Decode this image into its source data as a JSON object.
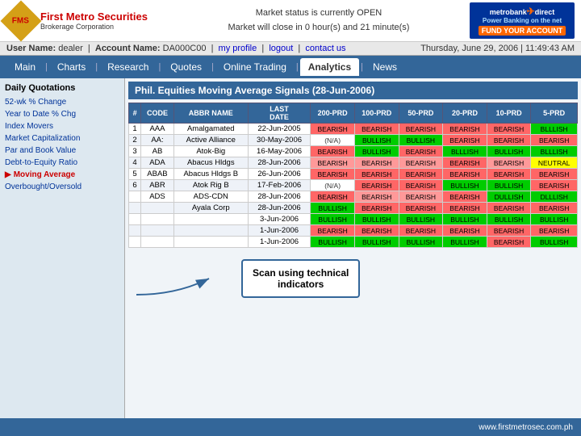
{
  "header": {
    "logo_name": "First Metro Securities",
    "logo_sub": "Brokerage Corporation",
    "market_status_line1": "Market status is currently OPEN",
    "market_status_line2": "Market will close in 0 hour(s) and 21 minute(s)",
    "metrobank_brand": "metrobank",
    "metrobank_direct": "direct",
    "metrobank_sub": "Power Banking on the net",
    "fund_btn": "FUND YOUR ACCOUNT"
  },
  "userbar": {
    "user_label": "User Name:",
    "user_value": "dealer",
    "account_label": "Account Name:",
    "account_value": "DA000C00",
    "links": [
      "my profile",
      "logout",
      "contact us"
    ],
    "datetime": "Thursday, June 29, 2006 | 11:49:43 AM"
  },
  "nav": {
    "items": [
      "Main",
      "Charts",
      "Research",
      "Quotes",
      "Online Trading",
      "Analytics",
      "News"
    ],
    "active": "Analytics"
  },
  "sidebar": {
    "title": "Daily Quotations",
    "items": [
      "52-wk % Change",
      "Year to Date % Chg",
      "Index Movers",
      "Market Capitalization",
      "Par and Book Value",
      "Debt-to-Equity Ratio",
      "Moving Average",
      "Overbought/Oversold"
    ],
    "active": "Moving Average"
  },
  "content": {
    "title": "Phil. Equities Moving Average Signals (28-Jun-2006)",
    "table_headers": [
      "#",
      "CODE",
      "ABBR NAME",
      "LAST DATE",
      "200-PRD",
      "100-PRD",
      "50-PRD",
      "20-PRD",
      "10-PRD",
      "5-PRD"
    ],
    "rows": [
      {
        "num": "1",
        "code": "AAA",
        "name": "Amalgamated",
        "date": "22-Jun-2005",
        "p200": "BEARISH",
        "p100": "BEARISH",
        "p50": "BEARISH",
        "p20": "BEARISH",
        "p10": "BEARISH",
        "p5": "BLLLISH",
        "c200": "bearish",
        "c100": "bearish",
        "c50": "bearish",
        "c20": "bearish",
        "c10": "bearish",
        "c5": "bullish"
      },
      {
        "num": "2",
        "code": "AA:",
        "name": "Active Alliance",
        "date": "30-May-2006",
        "p200": "(N/A)",
        "p100": "BULLISH",
        "p50": "BULLISH",
        "p20": "BEARISH",
        "p10": "BEARISH",
        "p5": "BEARISH",
        "c200": "na",
        "c100": "bullish",
        "c50": "bullish",
        "c20": "bearish",
        "c10": "bearish",
        "c5": "bearish"
      },
      {
        "num": "3",
        "code": "AB",
        "name": "Atok-Big",
        "date": "16-May-2006",
        "p200": "BEARISH",
        "p100": "BULLISH",
        "p50": "BEARISH",
        "p20": "BLLLISH",
        "p10": "BULLISH",
        "p5": "BLLLISH",
        "c200": "bearish",
        "c100": "bullish",
        "c50": "bearish",
        "c20": "bullish",
        "c10": "bullish",
        "c5": "bullish"
      },
      {
        "num": "4",
        "code": "ADA",
        "name": "Abacus Hldgs",
        "date": "28-Jun-2006",
        "p200": "BEARISH",
        "p100": "BEARISH",
        "p50": "BEARISH",
        "p20": "BEARISH",
        "p10": "BEARISH",
        "p5": "NEUTRAL",
        "c200": "dearish",
        "c100": "dearish",
        "c50": "dearish",
        "c20": "bearish",
        "c10": "dearish",
        "c5": "neutral"
      },
      {
        "num": "5",
        "code": "ABAB",
        "name": "Abacus Hldgs B",
        "date": "26-Jun-2006",
        "p200": "BEARISH",
        "p100": "BEARISH",
        "p50": "BEARISH",
        "p20": "BEARISH",
        "p10": "BEARISH",
        "p5": "BEARISH",
        "c200": "bearish",
        "c100": "bearish",
        "c50": "bearish",
        "c20": "bearish",
        "c10": "bearish",
        "c5": "bearish"
      },
      {
        "num": "6",
        "code": "ABR",
        "name": "Atok Rig B",
        "date": "17-Feb-2006",
        "p200": "(N/A)",
        "p100": "BEARISH",
        "p50": "BEARISH",
        "p20": "BULLISH",
        "p10": "BULLISH",
        "p5": "BEARISH",
        "c200": "na",
        "c100": "bearish",
        "c50": "bearish",
        "c20": "bullish",
        "c10": "bullish",
        "c5": "bearish"
      },
      {
        "num": "",
        "code": "ADS",
        "name": "ADS-CDN",
        "date": "28-Jun-2006",
        "p200": "BEARISH",
        "p100": "BEARISH",
        "p50": "BEARISH",
        "p20": "BEARISH",
        "p10": "DULLISH",
        "p5": "DLLLISH",
        "c200": "bearish",
        "c100": "dearish",
        "c50": "dearish",
        "c20": "bearish",
        "c10": "bullish",
        "c5": "bullish"
      },
      {
        "num": "",
        "code": "",
        "name": "Ayala Corp",
        "date": "28-Jun-2006",
        "p200": "BULLISH",
        "p100": "BEARISH",
        "p50": "BEARISH",
        "p20": "BEARISH",
        "p10": "BEARISH",
        "p5": "BEARISH",
        "c200": "bullish",
        "c100": "bearish",
        "c50": "bearish",
        "c20": "bearish",
        "c10": "bearish",
        "c5": "bearish"
      },
      {
        "num": "",
        "code": "",
        "name": "",
        "date": "3-Jun-2006",
        "p200": "BULLISH",
        "p100": "BULLISH",
        "p50": "BULLISH",
        "p20": "BULLISH",
        "p10": "BULLISH",
        "p5": "BULLISH",
        "c200": "bullish",
        "c100": "bullish",
        "c50": "bullish",
        "c20": "bullish",
        "c10": "bullish",
        "c5": "bullish"
      },
      {
        "num": "",
        "code": "",
        "name": "",
        "date": "1-Jun-2006",
        "p200": "BEARISH",
        "p100": "BEARISH",
        "p50": "BEARISH",
        "p20": "BEARISH",
        "p10": "BEARISH",
        "p5": "BEARISH",
        "c200": "bearish",
        "c100": "bearish",
        "c50": "bearish",
        "c20": "bearish",
        "c10": "bearish",
        "c5": "bearish"
      },
      {
        "num": "",
        "code": "",
        "name": "",
        "date": "1-Jun-2006",
        "p200": "BULLISH",
        "p100": "BULLISH",
        "p50": "BULLISH",
        "p20": "BULLISH",
        "p10": "BEARISH",
        "p5": "BULLISH",
        "c200": "bullish",
        "c100": "bullish",
        "c50": "bullish",
        "c20": "bullish",
        "c10": "bearish",
        "c5": "bullish"
      }
    ]
  },
  "callout": {
    "line1": "Scan using technical",
    "line2": "indicators"
  },
  "footer": {
    "url": "www.firstmetrosec.com.ph"
  }
}
